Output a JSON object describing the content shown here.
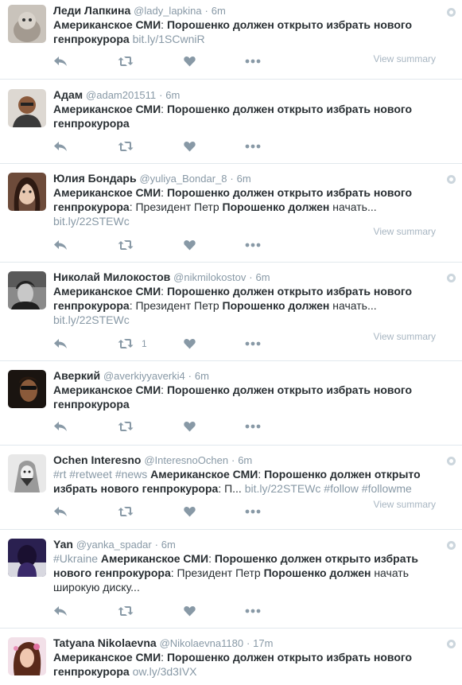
{
  "tweets": [
    {
      "fullname": "Леди Лапкина",
      "handle": "@lady_lapkina",
      "sep": "·",
      "time": "6m",
      "bold1": "Американское СМИ",
      "plain1": ": ",
      "bold2": "Порошенко должен открыто избрать нового генпрокурора",
      "link": "bit.ly/1SCwniR",
      "retweet_count": "",
      "summary": "View summary"
    },
    {
      "fullname": "Адам",
      "handle": "@adam201511",
      "sep": "·",
      "time": "6m",
      "bold1": "Американское СМИ",
      "plain1": ": ",
      "bold2": "Порошенко должен открыто избрать нового генпрокурора",
      "link": "",
      "retweet_count": "",
      "summary": ""
    },
    {
      "fullname": "Юлия Бондарь",
      "handle": "@yuliya_Bondar_8",
      "sep": "·",
      "time": "6m",
      "bold1": "Американское СМИ",
      "plain1": ": ",
      "bold2": "Порошенко должен открыто избрать нового генпрокурора",
      "plain2": ": Президент Петр ",
      "bold3": "Порошенко должен",
      "plain3": " начать...",
      "link": "bit.ly/22STEWc",
      "retweet_count": "",
      "summary": "View summary"
    },
    {
      "fullname": "Николай Милокостов",
      "handle": "@nikmilokostov",
      "sep": "·",
      "time": "6m",
      "bold1": "Американское СМИ",
      "plain1": ": ",
      "bold2": "Порошенко должен открыто избрать нового генпрокурора",
      "plain2": ": Президент Петр ",
      "bold3": "Порошенко должен",
      "plain3": " начать...",
      "link": "bit.ly/22STEWc",
      "retweet_count": "1",
      "summary": "View summary"
    },
    {
      "fullname": "Аверкий",
      "handle": "@averkiyyaverki4",
      "sep": "·",
      "time": "6m",
      "bold1": "Американское СМИ",
      "plain1": ": ",
      "bold2": "Порошенко должен открыто избрать нового генпрокурора",
      "link": "",
      "retweet_count": "",
      "summary": ""
    },
    {
      "fullname": "Ochen Interesno",
      "handle": "@InteresnoOchen",
      "sep": "·",
      "time": "6m",
      "hashtags1": "#rt #retweet #news ",
      "bold1": "Американское СМИ",
      "plain1": ": ",
      "bold2": "Порошенко должен открыто избрать нового генпрокурора",
      "plain2": ": П... ",
      "link": "bit.ly/22STEWc",
      "hashtags2": " #follow #followme",
      "retweet_count": "",
      "summary": "View summary"
    },
    {
      "fullname": "Yan",
      "handle": "@yanka_spadar",
      "sep": "·",
      "time": "6m",
      "hashtags1": "#Ukraine ",
      "bold1": "Американское СМИ",
      "plain1": ": ",
      "bold2": "Порошенко должен открыто избрать нового генпрокурора",
      "plain2": ": Президент Петр ",
      "bold3": "Порошенко должен",
      "plain3": " начать широкую диску...",
      "link": "",
      "retweet_count": "",
      "summary": ""
    },
    {
      "fullname": "Tatyana Nikolaevna",
      "handle": "@Nikolaevna1180",
      "sep": "·",
      "time": "17m",
      "bold1": "Американское СМИ",
      "plain1": ": ",
      "bold2": "Порошенко должен открыто избрать нового генпрокурора",
      "link": "ow.ly/3d3IVX",
      "retweet_count": "",
      "summary": ""
    }
  ],
  "icons": {
    "reply": "reply-icon",
    "retweet": "retweet-icon",
    "like": "heart-icon",
    "more": "more-icon",
    "globe": "globe-icon"
  },
  "colors": {
    "name": "#292f33",
    "meta": "#8899a6",
    "divider": "#e1e8ed",
    "icon": "#8899a6"
  }
}
